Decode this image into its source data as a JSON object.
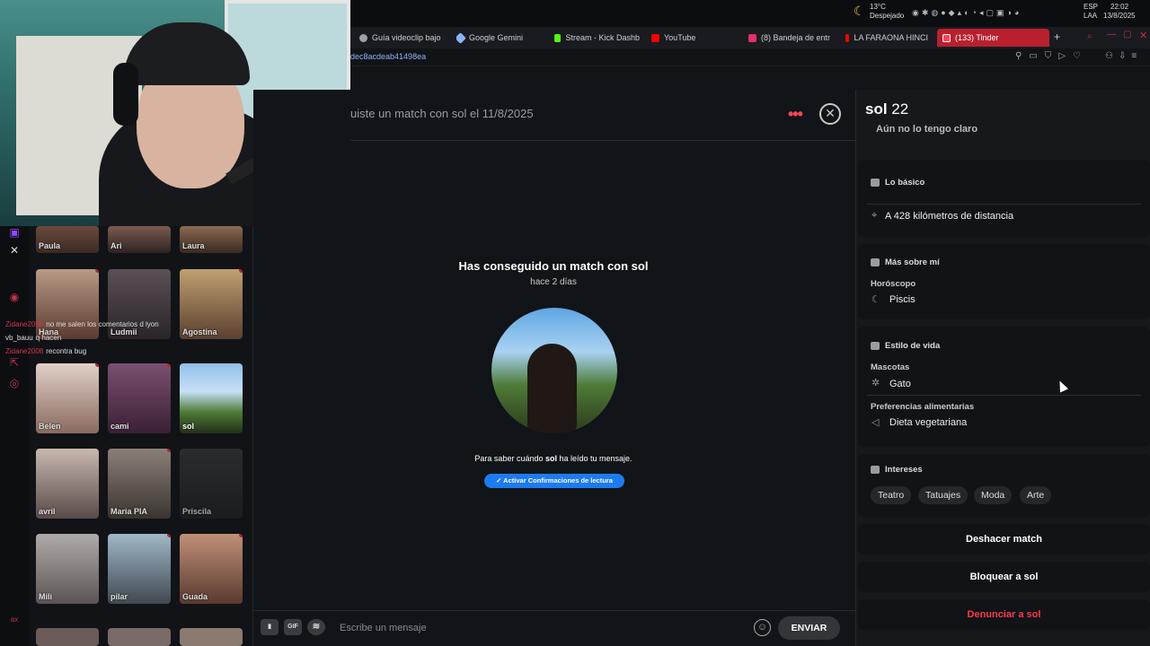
{
  "taskbar": {
    "weather_temp": "13°C",
    "weather_desc": "Despejado",
    "lang": "ESP",
    "lang2": "LAA",
    "time": "22:02",
    "date": "13/8/2025"
  },
  "tabs": [
    {
      "label": "Guía videoclip bajo",
      "icon": "globe-icon",
      "color": "#9aa0a6"
    },
    {
      "label": "Google Gemini",
      "icon": "gemini-icon",
      "color": "#8ab4f8"
    },
    {
      "label": "Stream - Kick Dashb",
      "icon": "kick-icon",
      "color": "#53fc18"
    },
    {
      "label": "YouTube",
      "icon": "youtube-icon",
      "color": "#ff0000"
    },
    {
      "label": "(8) Bandeja de entr",
      "icon": "instagram-icon",
      "color": "#e1306c"
    },
    {
      "label": "LA FARAONA HINCI",
      "icon": "youtube-icon",
      "color": "#ff0000"
    },
    {
      "label": "(133) Tinder",
      "icon": "tinder-icon",
      "color": "#ff4458"
    }
  ],
  "url": "dec8acdeab41498ea",
  "sidebar": {
    "cards": [
      {
        "name": "Paula"
      },
      {
        "name": "Ari"
      },
      {
        "name": "Laura"
      },
      {
        "name": "Hana"
      },
      {
        "name": "Ludmii"
      },
      {
        "name": "Agostina"
      },
      {
        "name": "Belen"
      },
      {
        "name": "cami"
      },
      {
        "name": "sol"
      },
      {
        "name": "avril"
      },
      {
        "name": "Maria PIA"
      },
      {
        "name": "Priscila"
      },
      {
        "name": "Mili"
      },
      {
        "name": "pilar"
      },
      {
        "name": "Guada"
      }
    ],
    "chat": [
      {
        "user": "Zidane2008",
        "text": "no me salen los comentarios d lyon"
      },
      {
        "user": "vb_bauu",
        "text": "q hacen"
      },
      {
        "user": "Zidane2008",
        "text": "recontra bug"
      }
    ],
    "side_label": "ax"
  },
  "conversation": {
    "header": "uiste un match con sol el 11/8/2025",
    "title_prefix": "Has conseguido un match con ",
    "title_name": "sol",
    "ago": "hace 2 días",
    "read_prefix": "Para saber cuándo ",
    "read_name": "sol",
    "read_suffix": " ha leído tu mensaje.",
    "read_button": "✓ Activar Confirmaciones de lectura",
    "composer_placeholder": "Escribe un mensaje",
    "send": "ENVIAR",
    "gif": "GIF"
  },
  "profile": {
    "name": "sol",
    "age": "22",
    "partial_text": "Aún no lo tengo claro",
    "basics_title": "Lo básico",
    "distance": "A 428 kilómetros de distancia",
    "about_title": "Más sobre mí",
    "horoscope_label": "Horóscopo",
    "horoscope": "Piscis",
    "lifestyle_title": "Estilo de vida",
    "pets_label": "Mascotas",
    "pets": "Gato",
    "diet_label": "Preferencias alimentarias",
    "diet": "Dieta vegetariana",
    "interests_title": "Intereses",
    "interests": [
      "Teatro",
      "Tatuajes",
      "Moda",
      "Arte"
    ],
    "unmatch": "Deshacer match",
    "block": "Bloquear a sol",
    "report": "Denunciar a sol"
  },
  "colors": {
    "accent": "#ff4458",
    "button_blue": "#1d7bf0",
    "danger": "#ff3a4c"
  }
}
